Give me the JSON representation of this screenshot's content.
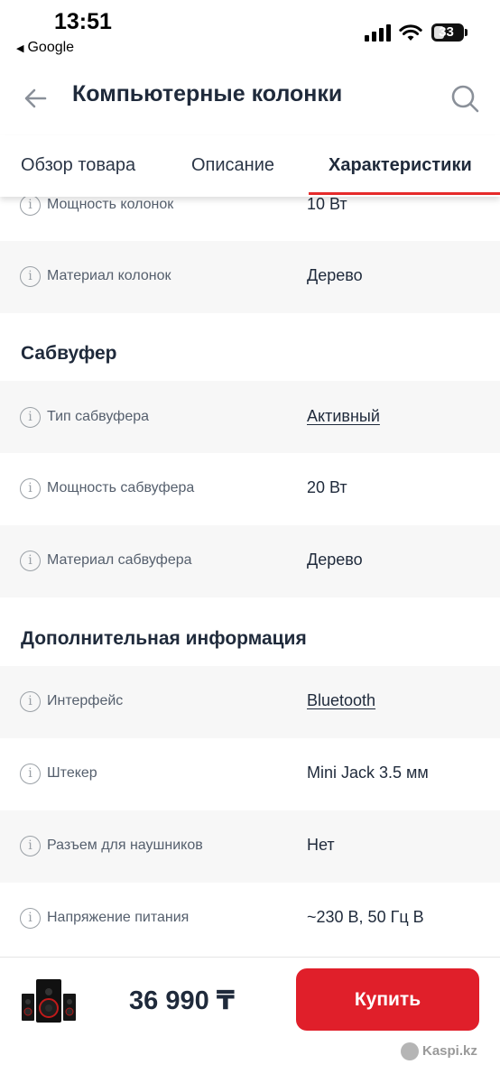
{
  "status_bar": {
    "time": "13:51",
    "back_app": "Google",
    "back_icon": "back-triangle-icon",
    "battery": "33"
  },
  "header": {
    "title": "Компьютерные колонки",
    "back_icon": "arrow-left-icon",
    "search_icon": "search-icon"
  },
  "tabs": [
    {
      "label": "Обзор товара",
      "active": false
    },
    {
      "label": "Описание",
      "active": false
    },
    {
      "label": "Характеристики",
      "active": true
    }
  ],
  "specs": {
    "top_rows": [
      {
        "label": "Мощность колонок",
        "value": "10 Вт",
        "link": false
      },
      {
        "label": "Материал колонок",
        "value": "Дерево",
        "link": false
      }
    ],
    "sections": [
      {
        "title": "Сабвуфер",
        "rows": [
          {
            "label": "Тип сабвуфера",
            "value": "Активный",
            "link": true
          },
          {
            "label": "Мощность сабвуфера",
            "value": "20 Вт",
            "link": false
          },
          {
            "label": "Материал сабвуфера",
            "value": "Дерево",
            "link": false
          }
        ]
      },
      {
        "title": "Дополнительная информация",
        "rows": [
          {
            "label": "Интерфейс",
            "value": "Bluetooth",
            "link": true
          },
          {
            "label": "Штекер",
            "value": "Mini Jack 3.5 мм",
            "link": false
          },
          {
            "label": "Разъем для наушников",
            "value": "Нет",
            "link": false
          },
          {
            "label": "Напряжение питания",
            "value": "~230 В, 50 Гц В",
            "link": false
          }
        ]
      }
    ]
  },
  "bottom_bar": {
    "price": "36 990 ₸",
    "buy_label": "Купить",
    "brand": "Kaspi.kz",
    "accent_color": "#e01f2a"
  }
}
